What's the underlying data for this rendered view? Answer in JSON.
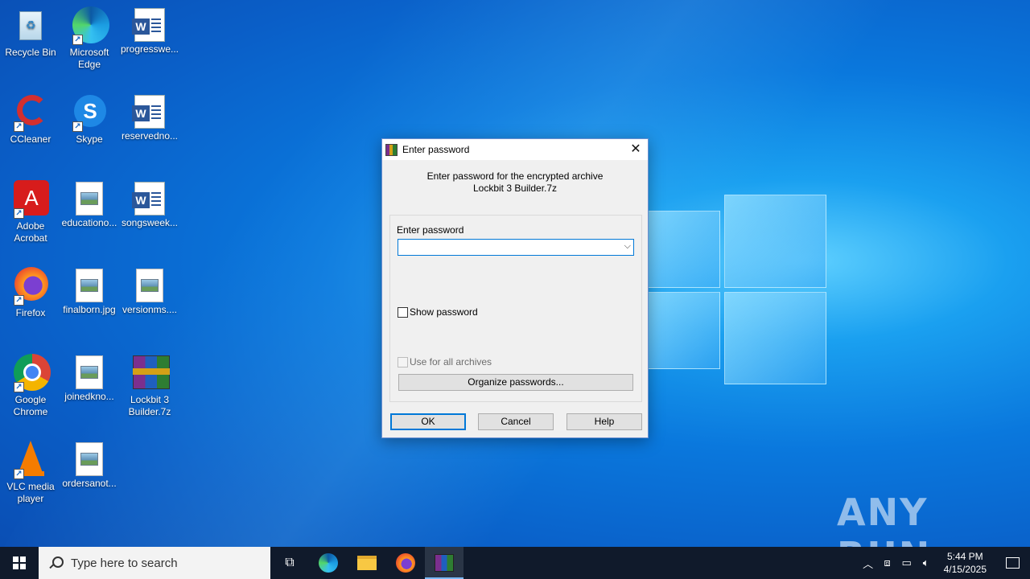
{
  "desktop": {
    "icons": [
      {
        "label": "Recycle Bin"
      },
      {
        "label": "Microsoft Edge"
      },
      {
        "label": "progresswe..."
      },
      {
        "label": "CCleaner"
      },
      {
        "label": "Skype"
      },
      {
        "label": "reservedno..."
      },
      {
        "label": "Adobe Acrobat"
      },
      {
        "label": "educationo..."
      },
      {
        "label": "songsweek..."
      },
      {
        "label": "Firefox"
      },
      {
        "label": "finalborn.jpg"
      },
      {
        "label": "versionms...."
      },
      {
        "label": "Google Chrome"
      },
      {
        "label": "joinedkno..."
      },
      {
        "label": "Lockbit 3 Builder.7z"
      },
      {
        "label": "VLC media player"
      },
      {
        "label": "ordersanot..."
      }
    ]
  },
  "dialog": {
    "title": "Enter password",
    "message_line1": "Enter password for the encrypted archive",
    "message_line2": "Lockbit 3 Builder.7z",
    "password_label": "Enter password",
    "password_value": "",
    "show_password_label": "Show password",
    "use_for_all_label": "Use for all archives",
    "organize_label": "Organize passwords...",
    "ok_label": "OK",
    "cancel_label": "Cancel",
    "help_label": "Help"
  },
  "taskbar": {
    "search_placeholder": "Type here to search",
    "time": "5:44 PM",
    "date": "4/15/2025"
  },
  "watermark": "ANY RUN"
}
